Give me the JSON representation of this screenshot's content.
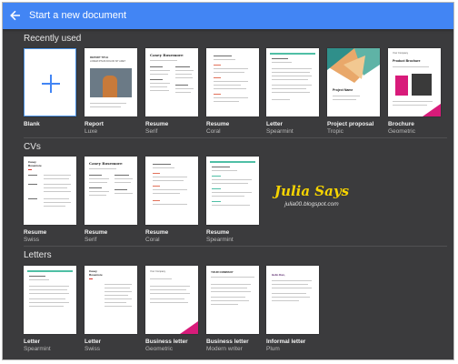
{
  "header": {
    "title": "Start a new document",
    "back_icon": "arrow-left-icon",
    "color": "#4285f4"
  },
  "sections": {
    "recent": {
      "title": "Recently used",
      "items": [
        {
          "name": "Blank",
          "sub": ""
        },
        {
          "name": "Report",
          "sub": "Luxe"
        },
        {
          "name": "Resume",
          "sub": "Serif"
        },
        {
          "name": "Resume",
          "sub": "Coral"
        },
        {
          "name": "Letter",
          "sub": "Spearmint"
        },
        {
          "name": "Project proposal",
          "sub": "Tropic"
        },
        {
          "name": "Brochure",
          "sub": "Geometric"
        }
      ]
    },
    "cvs": {
      "title": "CVs",
      "items": [
        {
          "name": "Resume",
          "sub": "Swiss"
        },
        {
          "name": "Resume",
          "sub": "Serif"
        },
        {
          "name": "Resume",
          "sub": "Coral"
        },
        {
          "name": "Resume",
          "sub": "Spearmint"
        }
      ]
    },
    "letters": {
      "title": "Letters",
      "items": [
        {
          "name": "Letter",
          "sub": "Spearmint"
        },
        {
          "name": "Letter",
          "sub": "Swiss"
        },
        {
          "name": "Business letter",
          "sub": "Geometric"
        },
        {
          "name": "Business letter",
          "sub": "Modern writer"
        },
        {
          "name": "Informal letter",
          "sub": "Plum"
        }
      ]
    }
  },
  "thumbs": {
    "report_luxe_heading": "REPORT TITLE",
    "report_luxe_sub": "LOREM IPSUM DOLOR SIT AMET",
    "resume_name": "Casey Rosemore",
    "proposal_title": "Project Name",
    "brochure_company": "Your Company",
    "brochure_title": "Product Brochure",
    "swiss_name": "Casey Rosemore",
    "modern_company": "YOUR COMPANY",
    "plum_greeting": "Hello Dan,"
  },
  "watermark": {
    "title": "Julia Says",
    "url": "julia00.blogspot.com"
  },
  "colors": {
    "background": "#3b3b3d",
    "spearmint": "#4fbfa5",
    "coral": "#e2725b",
    "geometric": "#d81b7a",
    "tropic": "#2f8f8a",
    "watermark": "#f6d400"
  }
}
